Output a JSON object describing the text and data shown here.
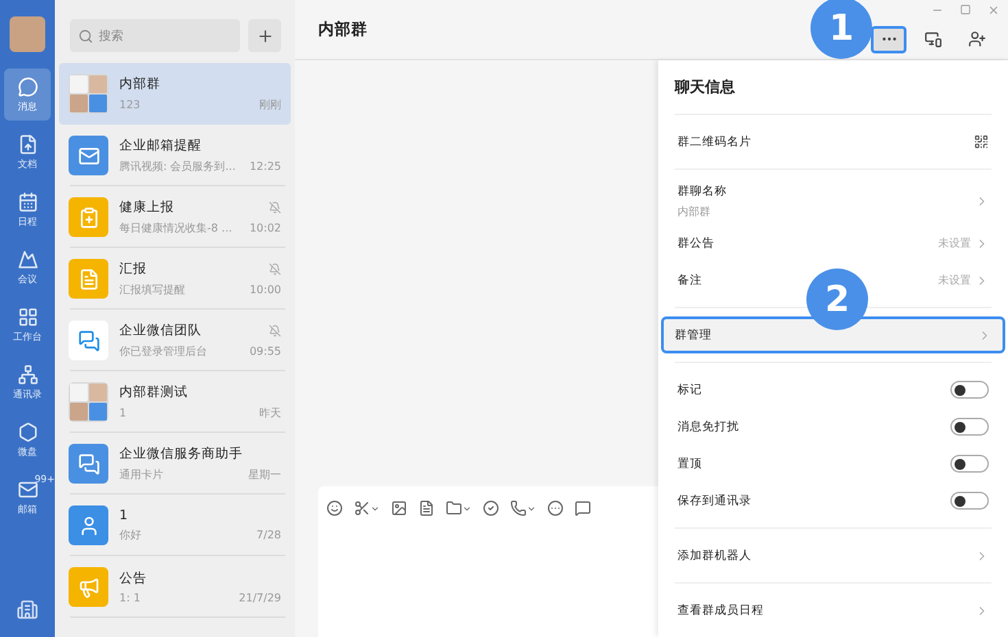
{
  "nav": {
    "items": [
      {
        "label": "消息",
        "selected": true
      },
      {
        "label": "文档",
        "selected": false
      },
      {
        "label": "日程",
        "selected": false
      },
      {
        "label": "会议",
        "selected": false
      },
      {
        "label": "工作台",
        "selected": false
      },
      {
        "label": "通讯录",
        "selected": false
      },
      {
        "label": "微盘",
        "selected": false
      },
      {
        "label": "邮箱",
        "selected": false,
        "badge": "99+"
      }
    ]
  },
  "chats": {
    "search": {
      "placeholder": "搜索"
    },
    "items": [
      {
        "name": "内部群",
        "preview": "123",
        "time": "刚刚",
        "kind": "group",
        "muted": false,
        "selected": true
      },
      {
        "name": "企业邮箱提醒",
        "preview": "腾讯视频: 会员服务到...",
        "time": "12:25",
        "kind": "mail",
        "muted": false,
        "selected": false
      },
      {
        "name": "健康上报",
        "preview": "每日健康情况收集-8 ...",
        "time": "10:02",
        "kind": "health",
        "muted": true,
        "selected": false
      },
      {
        "name": "汇报",
        "preview": "汇报填写提醒",
        "time": "10:00",
        "kind": "report",
        "muted": true,
        "selected": false
      },
      {
        "name": "企业微信团队",
        "preview": "你已登录管理后台",
        "time": "09:55",
        "kind": "wecom",
        "muted": true,
        "selected": false
      },
      {
        "name": "内部群测试",
        "preview": "1",
        "time": "昨天",
        "kind": "group",
        "muted": false,
        "selected": false
      },
      {
        "name": "企业微信服务商助手",
        "preview": "通用卡片",
        "time": "星期一",
        "kind": "service",
        "muted": false,
        "selected": false
      },
      {
        "name": "1",
        "preview": "你好",
        "time": "7/28",
        "kind": "person",
        "muted": false,
        "selected": false
      },
      {
        "name": "公告",
        "preview": "1: 1",
        "time": "21/7/29",
        "kind": "notice",
        "muted": false,
        "selected": false
      }
    ]
  },
  "chat": {
    "title": "内部群",
    "more_highlighted": true
  },
  "info": {
    "title": "聊天信息",
    "sections": [
      [
        {
          "kind": "qr",
          "label": "群二维码名片"
        }
      ],
      [
        {
          "kind": "link",
          "label": "群聊名称",
          "sub": "内部群"
        },
        {
          "kind": "link",
          "label": "群公告",
          "value": "未设置"
        },
        {
          "kind": "link",
          "label": "备注",
          "value": "未设置"
        }
      ],
      [
        {
          "kind": "link",
          "label": "群管理",
          "highlighted": true
        }
      ],
      [
        {
          "kind": "toggle",
          "label": "标记",
          "on": false
        },
        {
          "kind": "toggle",
          "label": "消息免打扰",
          "on": false
        },
        {
          "kind": "toggle",
          "label": "置顶",
          "on": false
        },
        {
          "kind": "toggle",
          "label": "保存到通讯录",
          "on": false
        }
      ],
      [
        {
          "kind": "link",
          "label": "添加群机器人"
        }
      ],
      [
        {
          "kind": "link",
          "label": "查看群成员日程"
        }
      ]
    ]
  },
  "steps": [
    "1",
    "2"
  ]
}
